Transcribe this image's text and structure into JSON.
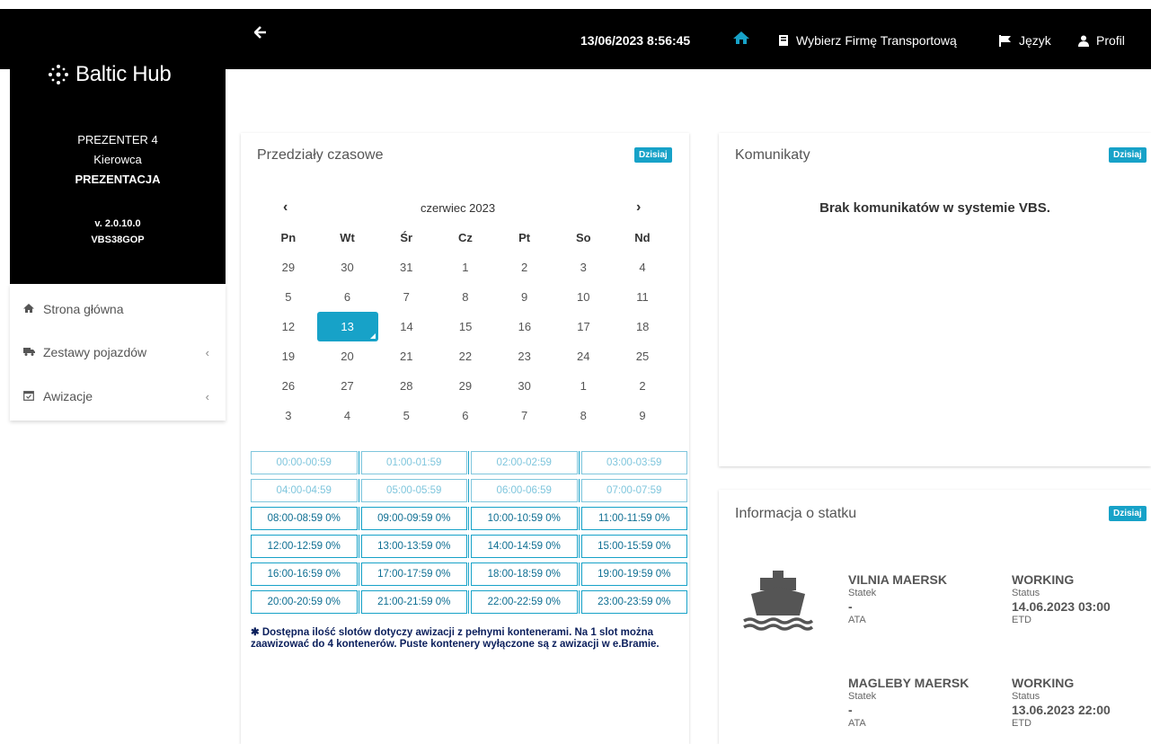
{
  "header": {
    "back_icon": "arrow-left-icon",
    "datetime": "13/06/2023 8:56:45",
    "firm_label": "Wybierz Firmę Transportową",
    "lang_label": "Język",
    "profile_label": "Profil"
  },
  "brand": {
    "name": "Baltic Hub"
  },
  "user": {
    "name": "PREZENTER 4",
    "role": "Kierowca",
    "company": "PREZENTACJA",
    "version": "v. 2.0.10.0",
    "code": "VBS38GOP"
  },
  "menu": [
    {
      "label": "Strona główna",
      "icon": "home-icon",
      "chevron": ""
    },
    {
      "label": "Zestawy pojazdów",
      "icon": "truck-icon",
      "chevron": "‹"
    },
    {
      "label": "Awizacje",
      "icon": "calendar-check-icon",
      "chevron": "‹"
    }
  ],
  "timeslots": {
    "title": "Przedziały czasowe",
    "badge": "Dzisiaj",
    "month": "czerwiec 2023",
    "prev": "‹",
    "next": "›",
    "weekdays": [
      "Pn",
      "Wt",
      "Śr",
      "Cz",
      "Pt",
      "So",
      "Nd"
    ],
    "weeks": [
      [
        "29",
        "30",
        "31",
        "1",
        "2",
        "3",
        "4"
      ],
      [
        "5",
        "6",
        "7",
        "8",
        "9",
        "10",
        "11"
      ],
      [
        "12",
        "13",
        "14",
        "15",
        "16",
        "17",
        "18"
      ],
      [
        "19",
        "20",
        "21",
        "22",
        "23",
        "24",
        "25"
      ],
      [
        "26",
        "27",
        "28",
        "29",
        "30",
        "1",
        "2"
      ],
      [
        "3",
        "4",
        "5",
        "6",
        "7",
        "8",
        "9"
      ]
    ],
    "selected": "13",
    "slots": [
      [
        "00:00-00:59",
        "01:00-01:59",
        "02:00-02:59",
        "03:00-03:59"
      ],
      [
        "04:00-04:59",
        "05:00-05:59",
        "06:00-06:59",
        "07:00-07:59"
      ],
      [
        "08:00-08:59 0%",
        "09:00-09:59 0%",
        "10:00-10:59 0%",
        "11:00-11:59 0%"
      ],
      [
        "12:00-12:59 0%",
        "13:00-13:59 0%",
        "14:00-14:59 0%",
        "15:00-15:59 0%"
      ],
      [
        "16:00-16:59 0%",
        "17:00-17:59 0%",
        "18:00-18:59 0%",
        "19:00-19:59 0%"
      ],
      [
        "20:00-20:59 0%",
        "21:00-21:59 0%",
        "22:00-22:59 0%",
        "23:00-23:59 0%"
      ]
    ],
    "note": "✱ Dostępna ilość slotów dotyczy awizacji z pełnymi kontenerami. Na 1 slot można zaawizować do 4 kontenerów. Puste kontenery wyłączone są z awizacji w e.Bramie."
  },
  "messages": {
    "title": "Komunikaty",
    "badge": "Dzisiaj",
    "empty_text": "Brak komunikatów w systemie VBS."
  },
  "ships": {
    "title": "Informacja o statku",
    "badge": "Dzisiaj",
    "items": [
      {
        "name": "VILNIA MAERSK",
        "name_label": "Statek",
        "ata": "-",
        "ata_label": "ATA",
        "status": "WORKING",
        "status_label": "Status",
        "etd": "14.06.2023 03:00",
        "etd_label": "ETD"
      },
      {
        "name": "MAGLEBY MAERSK",
        "name_label": "Statek",
        "ata": "-",
        "ata_label": "ATA",
        "status": "WORKING",
        "status_label": "Status",
        "etd": "13.06.2023 22:00",
        "etd_label": "ETD"
      }
    ]
  },
  "colors": {
    "accent": "#17a2c8",
    "dark": "#000000"
  }
}
